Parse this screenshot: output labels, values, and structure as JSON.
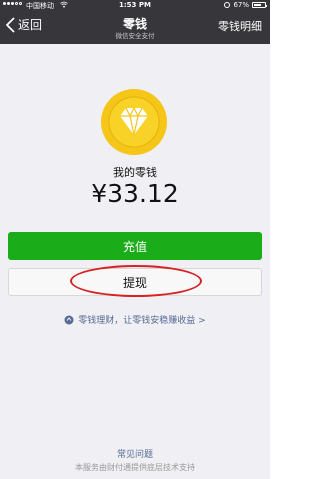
{
  "status_bar": {
    "carrier": "中国移动",
    "network": "WiFi",
    "time": "1:53 PM",
    "battery": "67%"
  },
  "nav": {
    "back_label": "返回",
    "title": "零钱",
    "subtitle": "微信安全支付",
    "right_label": "零钱明细"
  },
  "wallet": {
    "label": "我的零钱",
    "amount": "¥33.12"
  },
  "buttons": {
    "charge": "充值",
    "withdraw": "提现"
  },
  "finance_link": "零钱理财，让零钱安稳赚收益 >",
  "faq": "常见问题",
  "footer": "本服务由财付通提供底层技术支持",
  "colors": {
    "header": "#37363b",
    "background": "#efeff4",
    "primary_green": "#1aad19",
    "link": "#576b95",
    "coin_gold": "#f5c518",
    "annotation_red": "#d62222"
  },
  "icons": [
    "chevron-left-icon",
    "lock-icon",
    "battery-icon",
    "diamond-coin-icon",
    "finance-icon"
  ]
}
